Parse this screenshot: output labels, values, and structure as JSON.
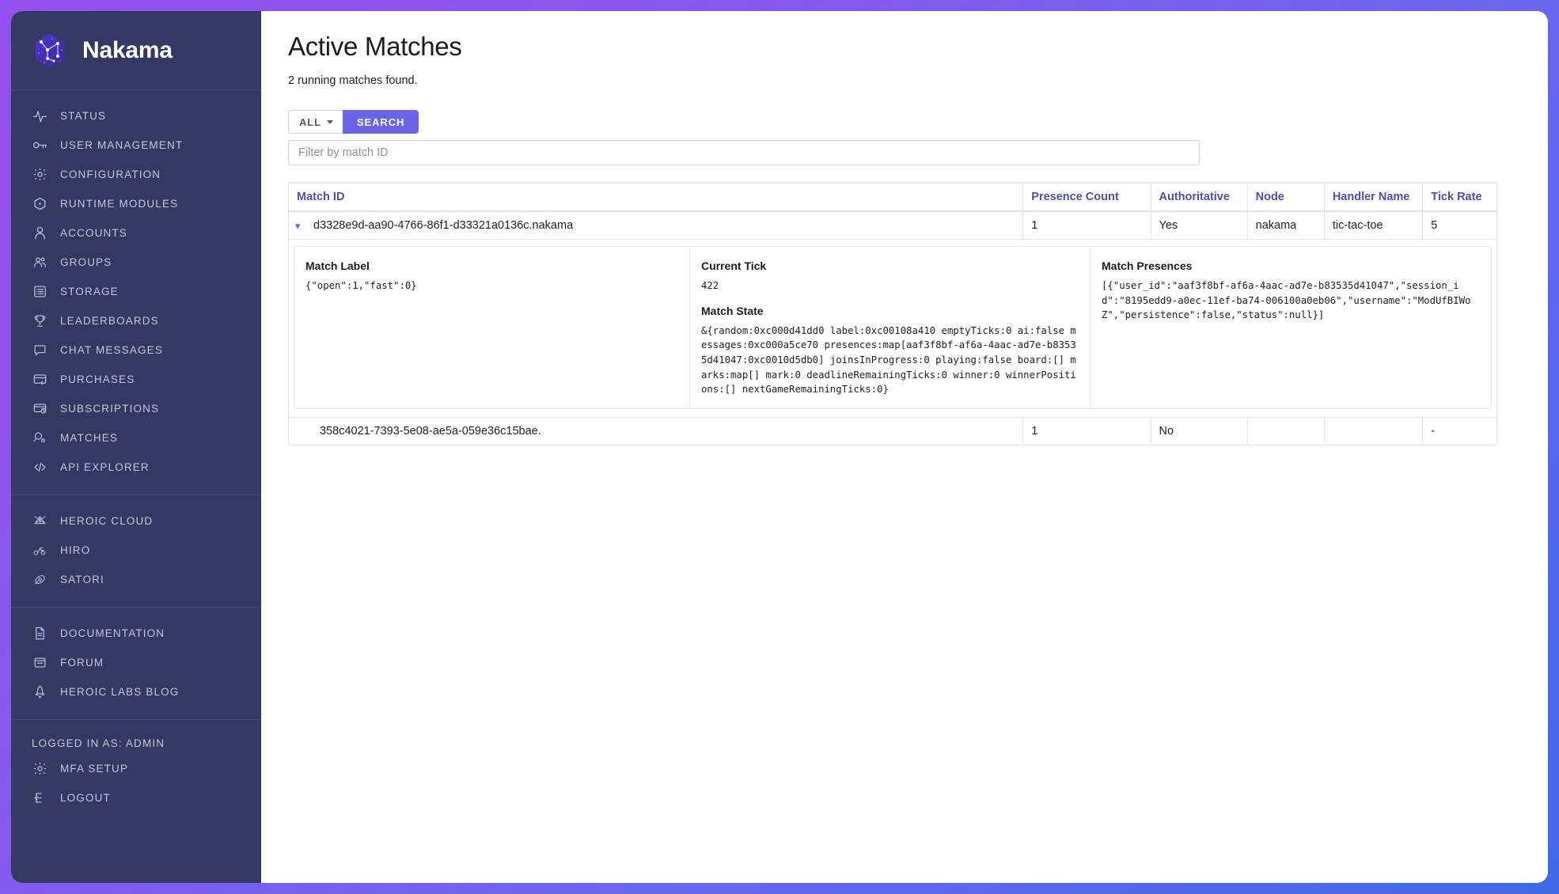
{
  "brand": {
    "title": "Nakama",
    "logo_icon": "nakama-hexagon-constellation-logo"
  },
  "sidebar": {
    "groups": [
      {
        "name": "primary-nav",
        "items": [
          {
            "label": "STATUS",
            "icon": "activity-pulse-icon"
          },
          {
            "label": "USER MANAGEMENT",
            "icon": "key-icon"
          },
          {
            "label": "CONFIGURATION",
            "icon": "gear-icon"
          },
          {
            "label": "RUNTIME MODULES",
            "icon": "hexagon-dot-icon"
          },
          {
            "label": "ACCOUNTS",
            "icon": "user-icon"
          },
          {
            "label": "GROUPS",
            "icon": "users-group-icon"
          },
          {
            "label": "STORAGE",
            "icon": "database-list-icon"
          },
          {
            "label": "LEADERBOARDS",
            "icon": "trophy-icon"
          },
          {
            "label": "CHAT MESSAGES",
            "icon": "chat-bubble-icon"
          },
          {
            "label": "PURCHASES",
            "icon": "card-return-icon"
          },
          {
            "label": "SUBSCRIPTIONS",
            "icon": "card-clock-icon"
          },
          {
            "label": "MATCHES",
            "icon": "magnifier-dot-icon"
          },
          {
            "label": "API EXPLORER",
            "icon": "code-brackets-icon"
          }
        ]
      },
      {
        "name": "products-nav",
        "items": [
          {
            "label": "HEROIC CLOUD",
            "icon": "cloud-net-icon"
          },
          {
            "label": "HIRO",
            "icon": "hiro-icon"
          },
          {
            "label": "SATORI",
            "icon": "satori-icon"
          }
        ]
      },
      {
        "name": "resources-nav",
        "items": [
          {
            "label": "DOCUMENTATION",
            "icon": "document-icon"
          },
          {
            "label": "FORUM",
            "icon": "forum-window-icon"
          },
          {
            "label": "HEROIC LABS BLOG",
            "icon": "rocket-icon"
          }
        ]
      }
    ],
    "account": {
      "logged_in_as": "LOGGED IN AS: ADMIN",
      "items": [
        {
          "label": "MFA SETUP",
          "icon": "gear-icon"
        },
        {
          "label": "LOGOUT",
          "icon": "logout-arrow-icon"
        }
      ]
    }
  },
  "main": {
    "title": "Active Matches",
    "subtitle": "2 running matches found.",
    "controls": {
      "filter_select_label": "ALL",
      "search_button_label": "SEARCH",
      "filter_input_placeholder": "Filter by match ID",
      "filter_input_value": ""
    },
    "table": {
      "columns": [
        "Match ID",
        "Presence Count",
        "Authoritative",
        "Node",
        "Handler Name",
        "Tick Rate"
      ],
      "rows": [
        {
          "match_id": "d3328e9d-aa90-4766-86f1-d33321a0136c.nakama",
          "expanded": true,
          "chevron_icon": "chevron-down-icon",
          "presence_count": "1",
          "authoritative": "Yes",
          "node": "nakama",
          "handler_name": "tic-tac-toe",
          "tick_rate": "5",
          "detail": {
            "match_label_heading": "Match Label",
            "match_label_value": "{\"open\":1,\"fast\":0}",
            "current_tick_heading": "Current Tick",
            "current_tick_value": "422",
            "match_state_heading": "Match State",
            "match_state_value": "&{random:0xc000d41dd0 label:0xc00108a410 emptyTicks:0 ai:false messages:0xc000a5ce70 presences:map[aaf3f8bf-af6a-4aac-ad7e-b83535d41047:0xc0010d5db0] joinsInProgress:0 playing:false board:[] marks:map[] mark:0 deadlineRemainingTicks:0 winner:0 winnerPositions:[] nextGameRemainingTicks:0}",
            "match_presences_heading": "Match Presences",
            "match_presences_value": "[{\"user_id\":\"aaf3f8bf-af6a-4aac-ad7e-b83535d41047\",\"session_id\":\"8195edd9-a0ec-11ef-ba74-006100a0eb06\",\"username\":\"ModUfBIWoZ\",\"persistence\":false,\"status\":null}]"
          }
        },
        {
          "match_id": "358c4021-7393-5e08-ae5a-059e36c15bae.",
          "expanded": false,
          "presence_count": "1",
          "authoritative": "No",
          "node": "",
          "handler_name": "",
          "tick_rate": "-"
        }
      ]
    }
  },
  "colors": {
    "sidebar_bg": "#343963",
    "accent_purple": "#6a64e8",
    "table_header_text": "#4e4fa6",
    "page_bg_gradient_start": "#9450ef",
    "page_bg_gradient_end": "#4168e8"
  }
}
